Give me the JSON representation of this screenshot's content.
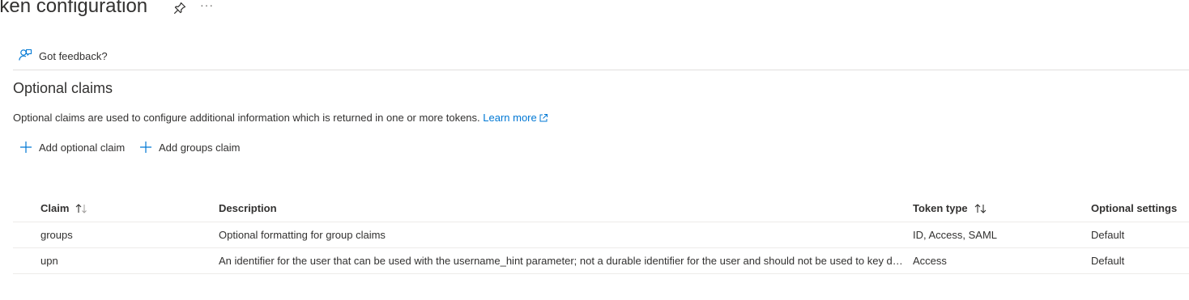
{
  "header": {
    "title": "oken configuration",
    "pin_icon": "pin-icon",
    "more_label": "···"
  },
  "feedback": {
    "icon": "feedback-person-icon",
    "label": "Got feedback?"
  },
  "section": {
    "title": "Optional claims",
    "description": "Optional claims are used to configure additional information which is returned in one or more tokens.",
    "learn_more": "Learn more",
    "link_color": "#0078d4"
  },
  "commands": {
    "add_optional_claim": "Add optional claim",
    "add_groups_claim": "Add groups claim"
  },
  "table": {
    "headers": {
      "claim": "Claim",
      "description": "Description",
      "token_type": "Token type",
      "optional_settings": "Optional settings"
    },
    "rows": [
      {
        "claim": "groups",
        "description": "Optional formatting for group claims",
        "token_type": "ID, Access, SAML",
        "optional_settings": "Default"
      },
      {
        "claim": "upn",
        "description": "An identifier for the user that can be used with the username_hint parameter; not a durable identifier for the user and should not be used to key data.",
        "token_type": "Access",
        "optional_settings": "Default"
      }
    ]
  }
}
